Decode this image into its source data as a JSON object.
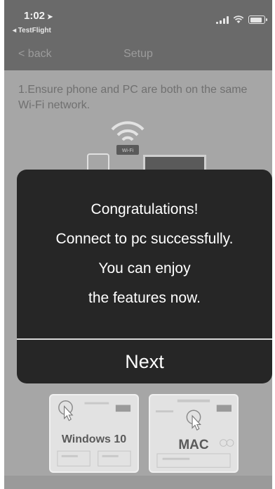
{
  "status_bar": {
    "time": "1:02",
    "location_glyph": "➤",
    "back_to_app": "◂ TestFlight"
  },
  "nav": {
    "back_label": "< back",
    "title": "Setup"
  },
  "content": {
    "step_text": "1.Ensure phone and PC are both on the same Wi-Fi network.",
    "wifi_tag": "Wi-Fi"
  },
  "modal": {
    "line1": "Congratulations!",
    "line2": "Connect to pc successfully.",
    "line3": "You can enjoy",
    "line4": "the features now.",
    "next_label": "Next"
  },
  "os_options": {
    "windows_label": "Windows 10",
    "mac_label": "MAC"
  },
  "colors": {
    "overlay_gray": "#a6a6a6",
    "modal_bg": "#262626",
    "modal_text": "#ffffff"
  },
  "icons": [
    "location-arrow-icon",
    "signal-icon",
    "wifi-status-icon",
    "battery-icon",
    "wifi-icon",
    "phone-icon",
    "pc-icon",
    "hand-pointer-icon"
  ]
}
